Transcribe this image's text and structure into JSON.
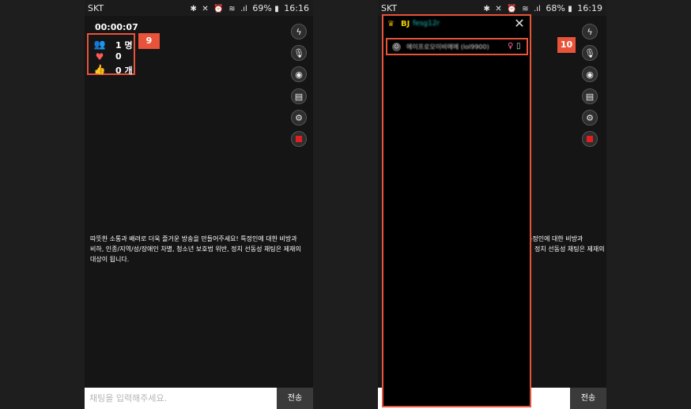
{
  "left_screen": {
    "status": {
      "carrier": "SKT",
      "battery": "69%",
      "time": "16:16"
    },
    "timer": "00:00:07",
    "stats": {
      "viewers": "1 명",
      "likes": "0",
      "recommends": "0 개"
    },
    "callout": "9",
    "notice": [
      "따뜻한 소통과 배려로 더욱 즐거운 방송을 만들어주세요! 특정인에 대한 비방과",
      "비하, 인종/지역/성/장애인 차별, 청소년 보호법 위반, 정치 선동성 채팅은 제재의",
      "대상이 됩니다."
    ],
    "chat": {
      "placeholder": "채팅을 입력해주세요.",
      "send_label": "전송"
    }
  },
  "right_screen": {
    "status": {
      "carrier": "SKT",
      "battery": "68%",
      "time": "16:19"
    },
    "panel": {
      "bj_label": "BJ",
      "bj_name": "fesg12r",
      "viewer_name": "에이프로모이비에에 (lol9900)",
      "viewer_gender": "♀"
    },
    "callout": "10",
    "notice": [
      "특정인에 대한 비방과",
      "정치 선동성 채팅은 제재의"
    ],
    "chat": {
      "send_label": "전송"
    }
  },
  "icons": {
    "flash": "flash-icon",
    "mic": "microphone-icon",
    "camera": "camera-icon",
    "chat": "chat-icon",
    "settings": "gear-icon",
    "record": "stop-record-icon"
  },
  "colors": {
    "highlight": "#e8533a",
    "record": "#e02020",
    "bj_label": "#f0d000"
  }
}
